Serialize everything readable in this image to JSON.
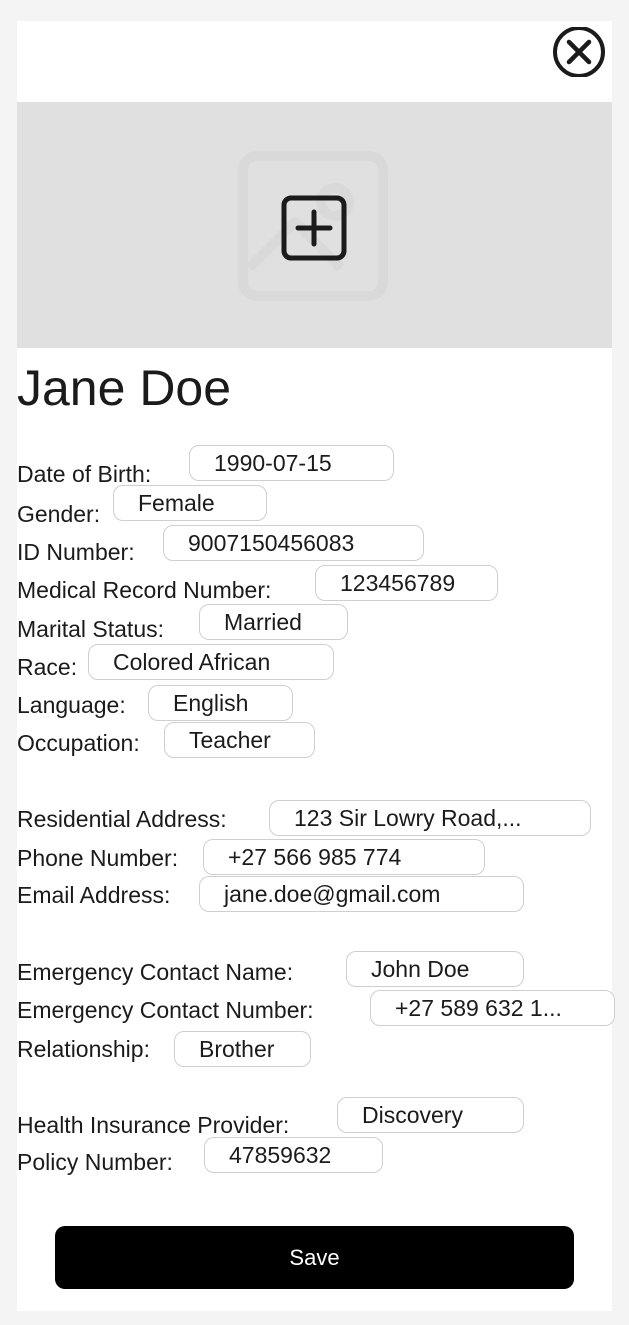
{
  "patient": {
    "name": "Jane Doe"
  },
  "fields": {
    "dob": {
      "label": "Date of Birth:",
      "value": "1990-07-15"
    },
    "gender": {
      "label": "Gender:",
      "value": "Female"
    },
    "id_number": {
      "label": "ID Number:",
      "value": "9007150456083"
    },
    "medical_record": {
      "label": "Medical Record Number:",
      "value": "123456789"
    },
    "marital_status": {
      "label": "Marital Status:",
      "value": "Married"
    },
    "race": {
      "label": "Race:",
      "value": "Colored African"
    },
    "language": {
      "label": "Language:",
      "value": "English"
    },
    "occupation": {
      "label": "Occupation:",
      "value": "Teacher"
    },
    "residential_address": {
      "label": "Residential Address:",
      "value": "123 Sir Lowry Road,..."
    },
    "phone": {
      "label": "Phone Number:",
      "value": "+27 566 985 774"
    },
    "email": {
      "label": "Email Address:",
      "value": "jane.doe@gmail.com"
    },
    "emergency_name": {
      "label": "Emergency Contact Name:",
      "value": "John Doe"
    },
    "emergency_number": {
      "label": "Emergency Contact Number:",
      "value": "+27 589 632 1..."
    },
    "relationship": {
      "label": "Relationship:",
      "value": "Brother"
    },
    "insurance_provider": {
      "label": "Health Insurance Provider:",
      "value": "Discovery"
    },
    "policy_number": {
      "label": "Policy Number:",
      "value": "47859632"
    }
  },
  "actions": {
    "save_label": "Save"
  },
  "icons": {
    "close": "close-circle-icon",
    "add_photo": "add-square-icon",
    "photo_placeholder": "image-placeholder-icon"
  },
  "colors": {
    "button_bg": "#000000",
    "button_text": "#ffffff",
    "photo_bg": "#e0e0e0",
    "field_border": "#cfcfcf"
  }
}
